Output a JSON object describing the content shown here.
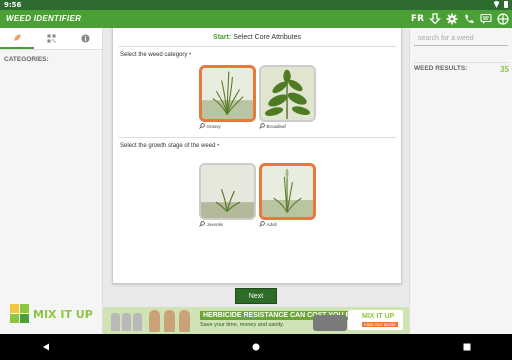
{
  "status": {
    "time": "9:56"
  },
  "app": {
    "title": "WEED IDENTIFIER",
    "language": "FR",
    "accent": "#4aa034",
    "actions": [
      "download-icon",
      "gear-icon",
      "phone-icon",
      "chat-icon",
      "target-icon"
    ]
  },
  "left": {
    "tabs": [
      "leaf-icon",
      "qr-icon",
      "info-icon"
    ],
    "categories_label": "CATEGORIES:",
    "logo_text": "MIX IT UP"
  },
  "right": {
    "search_placeholder": "search for a weed",
    "results_label": "WEED RESULTS:",
    "results_count": "35"
  },
  "card": {
    "start_label": "Start:",
    "heading": "Select Core Attributes",
    "section1": {
      "title": "Select the weed category",
      "marker": "•",
      "options": [
        {
          "label": "Grassy",
          "selected": true
        },
        {
          "label": "Broadleaf",
          "selected": false
        }
      ]
    },
    "section2": {
      "title": "Select the growth stage of the weed",
      "marker": "•",
      "options": [
        {
          "label": "Juvenile",
          "selected": false
        },
        {
          "label": "Adult",
          "selected": true
        }
      ]
    }
  },
  "next_label": "Next",
  "banner": {
    "headline": "HERBICIDE RESISTANCE CAN COST YOU BIG.",
    "sub": "Save your time, money and sanity.",
    "logo": "MIX IT UP",
    "logo_sub": "FIND OUT MORE"
  }
}
